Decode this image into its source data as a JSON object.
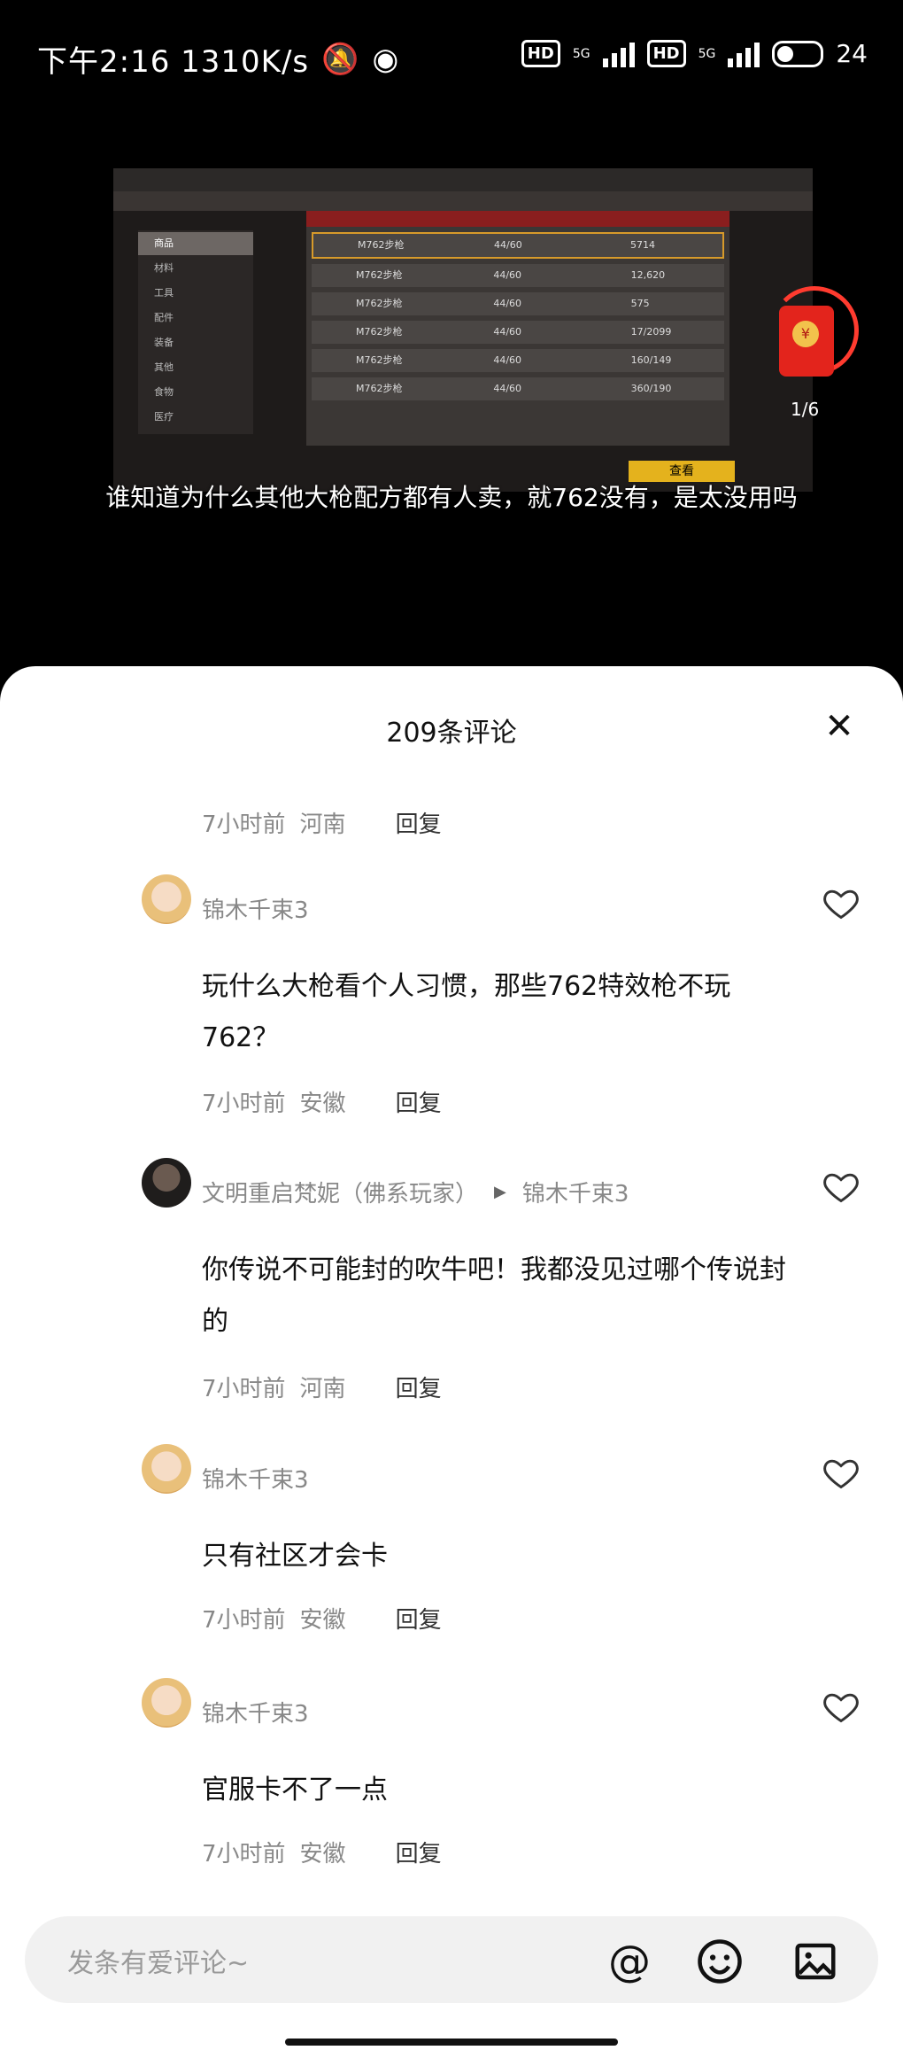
{
  "status_bar": {
    "time_speed": "下午2:16 1310K/s",
    "network_1": "5G",
    "network_2": "5G",
    "hd_1": "HD",
    "hd_2": "HD",
    "battery": "24"
  },
  "video": {
    "subtitle": "谁知道为什么其他大枪配方都有人卖，就762没有，是太没用吗",
    "game_rows": [
      {
        "name": "M762步枪",
        "qty": "44/60",
        "price": "5714"
      },
      {
        "name": "M762步枪",
        "qty": "44/60",
        "price": "12,620"
      },
      {
        "name": "M762步枪",
        "qty": "44/60",
        "price": "575"
      },
      {
        "name": "M762步枪",
        "qty": "44/60",
        "price": "17/2099"
      },
      {
        "name": "M762步枪",
        "qty": "44/60",
        "price": "160/149"
      },
      {
        "name": "M762步枪",
        "qty": "44/60",
        "price": "360/190"
      }
    ],
    "game_side": [
      "商品",
      "材料",
      "工具",
      "配件",
      "装备",
      "其他",
      "食物",
      "医疗"
    ],
    "game_button": "查看",
    "red_packet_count": "1/6"
  },
  "sheet": {
    "title": "209条评论",
    "close_icon": "close-icon"
  },
  "top_meta": {
    "time": "7小时前",
    "location": "河南",
    "reply": "回复"
  },
  "comments": [
    {
      "user": "锦木千束3",
      "text": "玩什么大枪看个人习惯，那些762特效枪不玩762？",
      "time": "7小时前",
      "location": "安徽",
      "reply": "回复"
    },
    {
      "user": "文明重启梵妮（佛系玩家）",
      "reply_to": "锦木千束3",
      "text": "你传说不可能封的吹牛吧！我都没见过哪个传说封的",
      "time": "7小时前",
      "location": "河南",
      "reply": "回复"
    },
    {
      "user": "锦木千束3",
      "text": "只有社区才会卡",
      "time": "7小时前",
      "location": "安徽",
      "reply": "回复"
    },
    {
      "user": "锦木千束3",
      "text": "官服卡不了一点",
      "time": "7小时前",
      "location": "安徽",
      "reply": "回复"
    }
  ],
  "input_bar": {
    "placeholder": "发条有爱评论~",
    "icons": [
      "at-icon",
      "emoji-icon",
      "image-icon"
    ]
  },
  "colors": {
    "sheet_bg": "#ffffff",
    "accent_red": "#e3241c",
    "game_highlight": "#e4b21d"
  }
}
